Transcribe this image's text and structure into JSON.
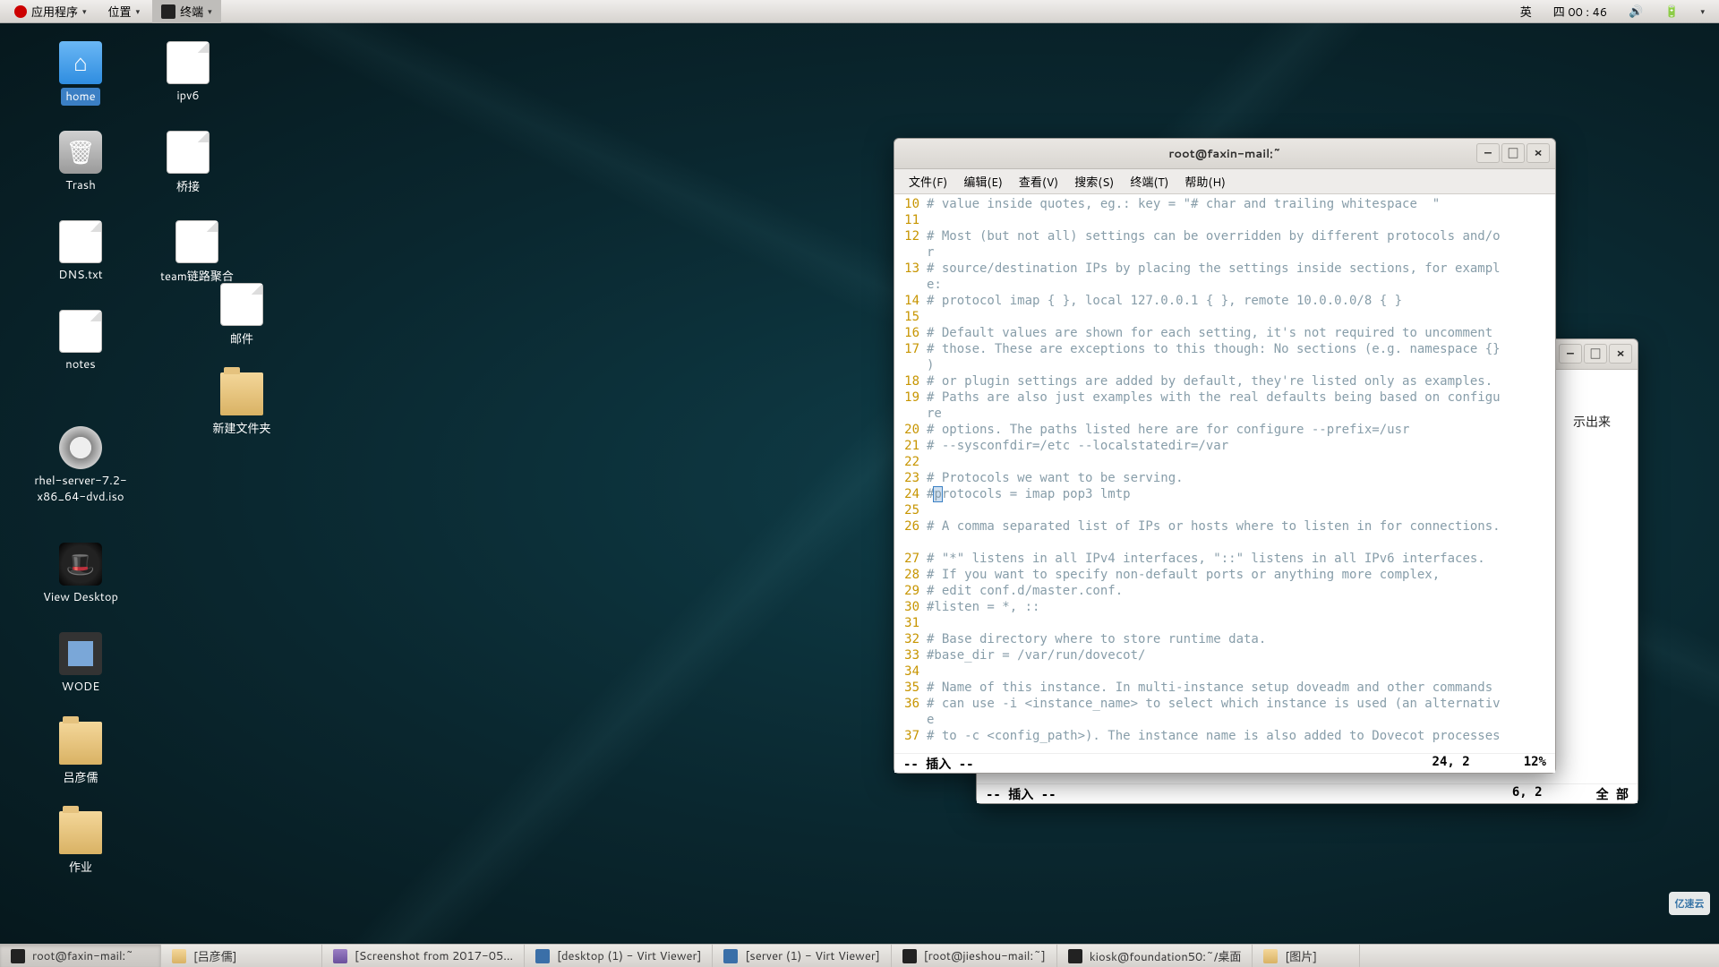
{
  "panel": {
    "apps": "应用程序",
    "places": "位置",
    "task": "终端",
    "ime": "英",
    "clock": "四 00 : 46"
  },
  "icons": {
    "home": {
      "label": "home"
    },
    "ipv6": {
      "label": "ipv6"
    },
    "trash": {
      "label": "Trash"
    },
    "bridge": {
      "label": "桥接"
    },
    "dns": {
      "label": "DNS.txt"
    },
    "team": {
      "label": "team链路聚合"
    },
    "notes": {
      "label": "notes"
    },
    "mail": {
      "label": "邮件"
    },
    "newf": {
      "label": "新建文件夹"
    },
    "iso": {
      "label": "rhel-server-7.2-x86_64-dvd.iso"
    },
    "viewd": {
      "label": "View Desktop"
    },
    "wode": {
      "label": "WODE"
    },
    "lyb": {
      "label": "吕彦儒"
    },
    "zuoye": {
      "label": "作业"
    }
  },
  "bg_win": {
    "text_right": "示出来",
    "status_mode": "-- 插入 --",
    "status_pos": "6, 2",
    "status_pct": "全 部"
  },
  "term": {
    "title": "root@faxin-mail:~",
    "menu": {
      "file": "文件(F)",
      "edit": "编辑(E)",
      "view": "查看(V)",
      "search": "搜索(S)",
      "terminal": "终端(T)",
      "help": "帮助(H)"
    },
    "lines": {
      "10": "# value inside quotes, eg.: key = \"# char and trailing whitespace  \"",
      "11": "",
      "12": "# Most (but not all) settings can be overridden by different protocols and/o",
      "12b": "r",
      "13": "# source/destination IPs by placing the settings inside sections, for exampl",
      "13b": "e:",
      "14": "# protocol imap { }, local 127.0.0.1 { }, remote 10.0.0.0/8 { }",
      "15": "",
      "16": "# Default values are shown for each setting, it's not required to uncomment",
      "17": "# those. These are exceptions to this though: No sections (e.g. namespace {}",
      "17b": ")",
      "18": "# or plugin settings are added by default, they're listed only as examples.",
      "19": "# Paths are also just examples with the real defaults being based on configu",
      "19b": "re",
      "20": "# options. The paths listed here are for configure --prefix=/usr",
      "21": "# --sysconfdir=/etc --localstatedir=/var",
      "22": "",
      "23": "# Protocols we want to be serving.",
      "24a": "#",
      "24b": "p",
      "24c": "rotocols = imap pop3 lmtp",
      "25": "",
      "26": "# A comma separated list of IPs or hosts where to listen in for connections.",
      "27": "# \"*\" listens in all IPv4 interfaces, \"::\" listens in all IPv6 interfaces.",
      "28": "# If you want to specify non-default ports or anything more complex,",
      "29": "# edit conf.d/master.conf.",
      "30": "#listen = *, ::",
      "31": "",
      "32": "# Base directory where to store runtime data.",
      "33": "#base_dir = /var/run/dovecot/",
      "34": "",
      "35": "# Name of this instance. In multi-instance setup doveadm and other commands",
      "36": "# can use -i <instance_name> to select which instance is used (an alternativ",
      "36b": "e",
      "37": "# to -c <config_path>). The instance name is also added to Dovecot processes"
    },
    "status_mode": "-- 插入 --",
    "status_pos": "24, 2",
    "status_pct": "12%"
  },
  "taskbar": {
    "t1": "root@faxin-mail:~",
    "t2": "[吕彦儒]",
    "t3": "[Screenshot from 2017-05…",
    "t4": "[desktop (1) - Virt Viewer]",
    "t5": "[server (1) - Virt Viewer]",
    "t6": "[root@jieshou-mail:~]",
    "t7": "kiosk@foundation50:~/桌面",
    "t8": "[图片]"
  },
  "watermark": "亿速云"
}
